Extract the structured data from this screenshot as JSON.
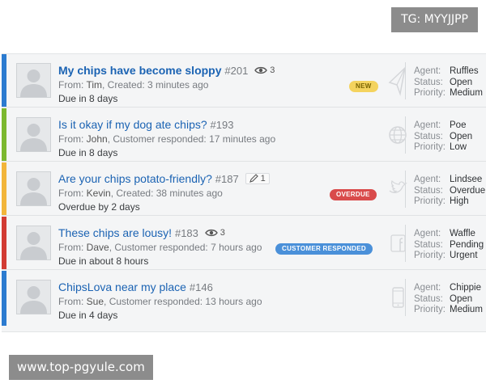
{
  "watermark_top": "TG: MYYJJPP",
  "watermark_bottom": "www.top-pgyule.com",
  "labels": {
    "agent": "Agent:",
    "status": "Status:",
    "priority": "Priority:"
  },
  "colors": {
    "link": "#1b63b3",
    "priority_medium": "#2b7bd0",
    "priority_low": "#7cb82f",
    "priority_high": "#f2b53a",
    "priority_urgent": "#d23b33",
    "badge_new": "#f4d35e",
    "badge_overdue": "#d94b4b",
    "badge_responded": "#4a90d9"
  },
  "tickets": [
    {
      "subject": "My chips have become sloppy",
      "number": "#201",
      "meta_icon": "eye-icon",
      "meta_count": "3",
      "from_prefix": "From: ",
      "from_name": "Tim",
      "from_sep": ", ",
      "activity": "Created: 3 minutes ago",
      "due": "Due in 8 days",
      "badge": "NEW",
      "channel_icon": "paper-plane-icon",
      "agent": "Ruffles",
      "status": "Open",
      "priority": "Medium"
    },
    {
      "subject": "Is it okay if my dog ate chips?",
      "number": "#193",
      "from_prefix": "From: ",
      "from_name": "John",
      "from_sep": ", ",
      "activity": "Customer responded: 17 minutes ago",
      "due": "Due in 8 days",
      "channel_icon": "globe-icon",
      "agent": "Poe",
      "status": "Open",
      "priority": "Low"
    },
    {
      "subject": "Are your chips potato-friendly?",
      "number": "#187",
      "meta_icon": "pencil-icon",
      "meta_count": "1",
      "from_prefix": "From: ",
      "from_name": "Kevin",
      "from_sep": ", ",
      "activity": "Created: 38 minutes ago",
      "due": "Overdue by 2 days",
      "badge": "OVERDUE",
      "channel_icon": "twitter-bird-icon",
      "agent": "Lindsee",
      "status": "Overdue",
      "priority": "High"
    },
    {
      "subject": "These chips are lousy!",
      "number": "#183",
      "meta_icon": "eye-icon",
      "meta_count": "3",
      "from_prefix": "From: ",
      "from_name": "Dave",
      "from_sep": ", ",
      "activity": "Customer responded: 7 hours ago",
      "due": "Due in about 8 hours",
      "badge": "CUSTOMER RESPONDED",
      "channel_icon": "facebook-icon",
      "agent": "Waffle",
      "status": "Pending",
      "priority": "Urgent"
    },
    {
      "subject": "ChipsLova near my place",
      "number": "#146",
      "from_prefix": "From: ",
      "from_name": "Sue",
      "from_sep": ", ",
      "activity": "Customer responded: 13 hours ago",
      "due": "Due in 4 days",
      "channel_icon": "mobile-phone-icon",
      "agent": "Chippie",
      "status": "Open",
      "priority": "Medium"
    }
  ]
}
